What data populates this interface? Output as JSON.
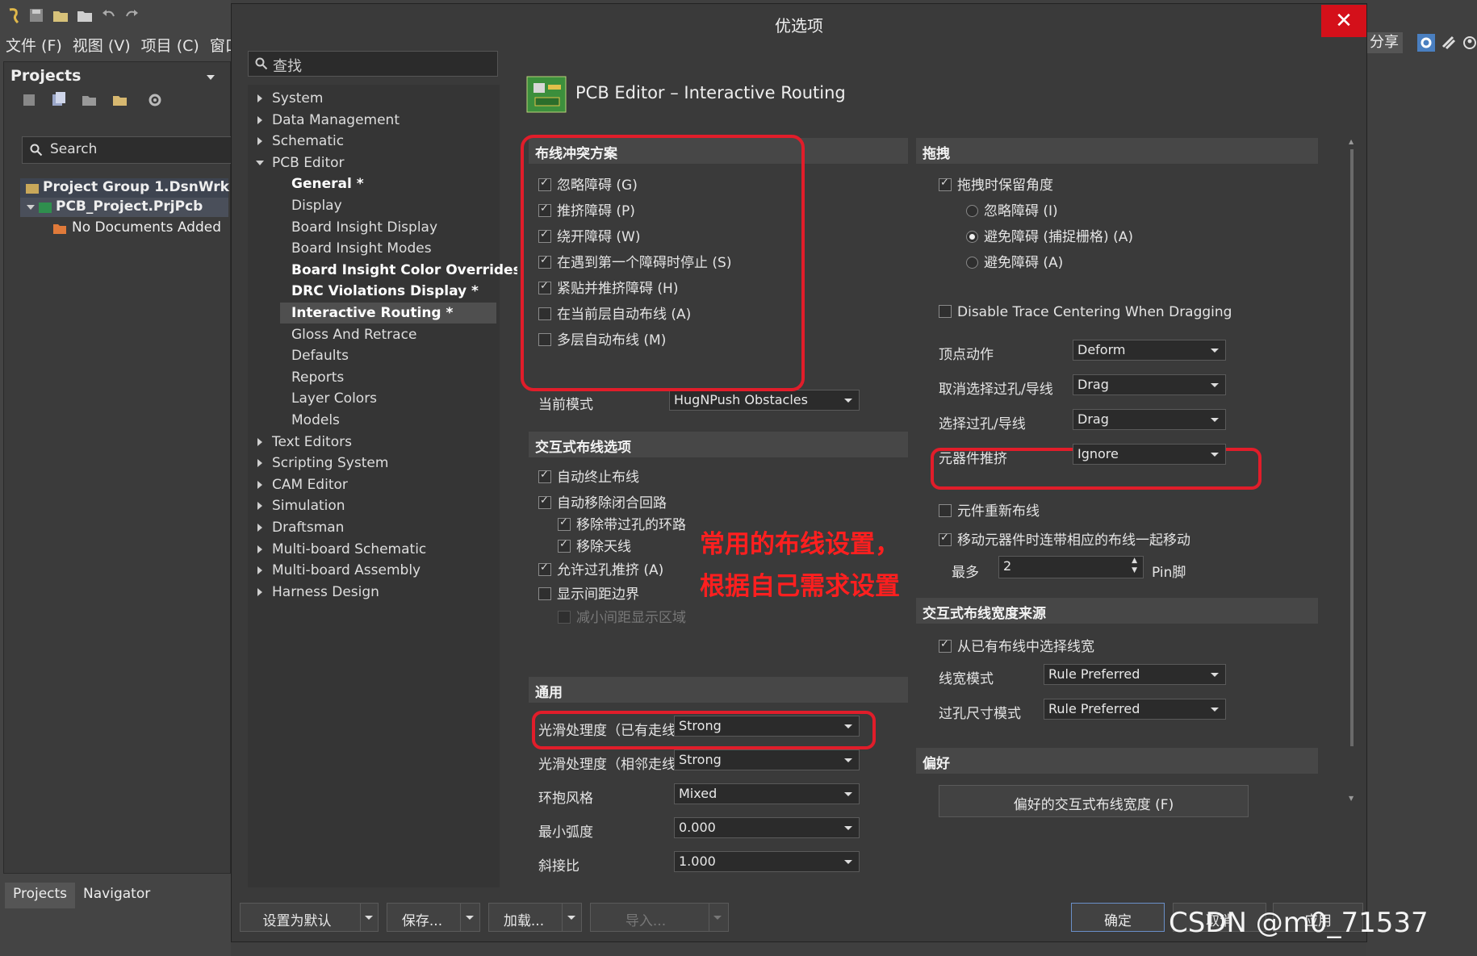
{
  "ide": {
    "menu": [
      "文件 (F)",
      "视图 (V)",
      "项目 (C)",
      "窗口 ("
    ],
    "projects_panel_title": "Projects",
    "search_placeholder": "Search",
    "tree": {
      "group": "Project Group 1.DsnWrk",
      "project": "PCB_Project.PrjPcb",
      "no_docs": "No Documents Added"
    },
    "tabs": [
      "Projects",
      "Navigator"
    ],
    "share_label": "分享"
  },
  "dialog": {
    "title": "优选项",
    "close_icon": "✕",
    "nav_search_placeholder": "查找",
    "nav": [
      {
        "label": "System",
        "level": 0,
        "expand": "closed"
      },
      {
        "label": "Data Management",
        "level": 0,
        "expand": "closed"
      },
      {
        "label": "Schematic",
        "level": 0,
        "expand": "closed"
      },
      {
        "label": "PCB Editor",
        "level": 0,
        "expand": "open"
      },
      {
        "label": "General *",
        "level": 1,
        "bold": true
      },
      {
        "label": "Display",
        "level": 1
      },
      {
        "label": "Board Insight Display",
        "level": 1
      },
      {
        "label": "Board Insight Modes",
        "level": 1
      },
      {
        "label": "Board Insight Color Overrides *",
        "level": 1,
        "bold": true
      },
      {
        "label": "DRC Violations Display *",
        "level": 1,
        "bold": true
      },
      {
        "label": "Interactive Routing *",
        "level": 1,
        "bold": true,
        "selected": true
      },
      {
        "label": "Gloss And Retrace",
        "level": 1
      },
      {
        "label": "Defaults",
        "level": 1
      },
      {
        "label": "Reports",
        "level": 1
      },
      {
        "label": "Layer Colors",
        "level": 1
      },
      {
        "label": "Models",
        "level": 1
      },
      {
        "label": "Text Editors",
        "level": 0,
        "expand": "closed"
      },
      {
        "label": "Scripting System",
        "level": 0,
        "expand": "closed"
      },
      {
        "label": "CAM Editor",
        "level": 0,
        "expand": "closed"
      },
      {
        "label": "Simulation",
        "level": 0,
        "expand": "closed"
      },
      {
        "label": "Draftsman",
        "level": 0,
        "expand": "closed"
      },
      {
        "label": "Multi-board Schematic",
        "level": 0,
        "expand": "closed"
      },
      {
        "label": "Multi-board Assembly",
        "level": 0,
        "expand": "closed"
      },
      {
        "label": "Harness Design",
        "level": 0,
        "expand": "closed"
      }
    ],
    "page_title": "PCB Editor – Interactive Routing",
    "left": {
      "conflict_title": "布线冲突方案",
      "conflict_options": [
        {
          "label": "忽略障碍 (G)",
          "checked": true
        },
        {
          "label": "推挤障碍 (P)",
          "checked": true
        },
        {
          "label": "绕开障碍 (W)",
          "checked": true
        },
        {
          "label": "在遇到第一个障碍时停止 (S)",
          "checked": true
        },
        {
          "label": "紧贴并推挤障碍 (H)",
          "checked": true
        },
        {
          "label": "在当前层自动布线 (A)",
          "checked": false
        },
        {
          "label": "多层自动布线 (M)",
          "checked": false
        }
      ],
      "current_mode_label": "当前模式",
      "current_mode_value": "HugNPush Obstacles",
      "interactive_title": "交互式布线选项",
      "interactive_options": [
        {
          "label": "自动终止布线",
          "checked": true,
          "indent": 0
        },
        {
          "label": "自动移除闭合回路",
          "checked": true,
          "indent": 0
        },
        {
          "label": "移除带过孔的环路",
          "checked": true,
          "indent": 1
        },
        {
          "label": "移除天线",
          "checked": true,
          "indent": 1
        },
        {
          "label": "允许过孔推挤 (A)",
          "checked": true,
          "indent": 0
        },
        {
          "label": "显示间距边界",
          "checked": false,
          "indent": 0
        },
        {
          "label": "减小间距显示区域",
          "checked": false,
          "indent": 1,
          "disabled": true
        }
      ],
      "general_title": "通用",
      "general_fields": [
        {
          "label": "光滑处理度（已有走线）",
          "value": "Strong"
        },
        {
          "label": "光滑处理度（相邻走线）",
          "value": "Strong"
        },
        {
          "label": "环抱风格",
          "value": "Mixed"
        },
        {
          "label": "最小弧度",
          "value": "0.000"
        },
        {
          "label": "斜接比",
          "value": "1.000"
        }
      ]
    },
    "right": {
      "drag_title": "拖拽",
      "keep_angle": {
        "label": "拖拽时保留角度",
        "checked": true
      },
      "drag_radios": [
        {
          "label": "忽略障碍 (I)",
          "on": false
        },
        {
          "label": "避免障碍 (捕捉栅格) (A)",
          "on": true
        },
        {
          "label": "避免障碍 (A)",
          "on": false
        }
      ],
      "disable_centering": {
        "label": "Disable Trace Centering When Dragging",
        "checked": false
      },
      "drag_fields": [
        {
          "label": "顶点动作",
          "value": "Deform"
        },
        {
          "label": "取消选择过孔/导线",
          "value": "Drag"
        },
        {
          "label": "选择过孔/导线",
          "value": "Drag"
        },
        {
          "label": "元器件推挤",
          "value": "Ignore"
        }
      ],
      "reroute": {
        "label": "元件重新布线",
        "checked": false
      },
      "move_with": {
        "label": "移动元器件时连带相应的布线一起移动",
        "checked": true
      },
      "max_label": "最多",
      "max_value": "2",
      "max_unit": "Pin脚",
      "width_title": "交互式布线宽度来源",
      "pick_existing": {
        "label": "从已有布线中选择线宽",
        "checked": true
      },
      "width_fields": [
        {
          "label": "线宽模式",
          "value": "Rule Preferred"
        },
        {
          "label": "过孔尺寸模式",
          "value": "Rule Preferred"
        }
      ],
      "pref_title": "偏好",
      "pref_button": "偏好的交互式布线宽度 (F)"
    },
    "annotation": [
      "常用的布线设置，",
      "根据自己需求设置"
    ],
    "footer": {
      "set_default": "设置为默认",
      "save": "保存...",
      "load": "加载...",
      "import": "导入...",
      "ok": "确定",
      "cancel": "取消",
      "apply": "应用"
    },
    "watermark": "CSDN @m0_71537"
  },
  "colors": {
    "highlight_red": "#e11d2a",
    "annotation_red": "#ff1f1f",
    "close_red": "#d4101a"
  }
}
